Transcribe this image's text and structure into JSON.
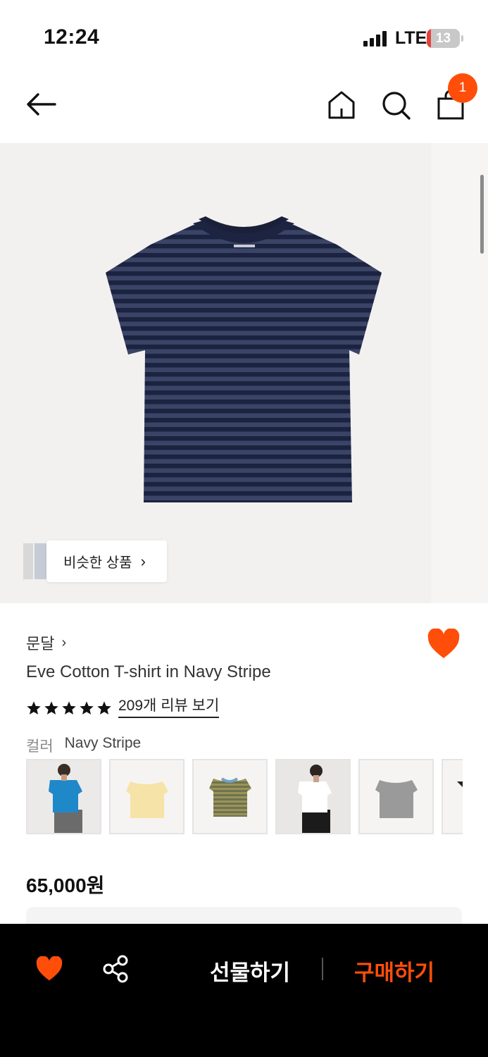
{
  "status_bar": {
    "time": "12:24",
    "network": "LTE",
    "battery": "13",
    "battery_level": 0.13
  },
  "top_nav": {
    "back_icon": "arrow-left-icon",
    "home_icon": "home-icon",
    "search_icon": "search-icon",
    "cart_icon": "shopping-bag-icon",
    "cart_count": "1",
    "badge_color": "#ff4e0a"
  },
  "hero": {
    "product_image": "navy-striped-tshirt",
    "similar_label": "비슷한 상품",
    "similar_chevron": "›"
  },
  "product": {
    "brand": "문달",
    "brand_chevron": "›",
    "title": "Eve Cotton T-shirt in Navy Stripe",
    "rating_stars": 5,
    "review_link": "209개 리뷰 보기",
    "color_label": "컬러",
    "color_value": "Navy Stripe",
    "swatches": [
      {
        "name": "blue-model"
      },
      {
        "name": "butter-yellow"
      },
      {
        "name": "olive-stripe"
      },
      {
        "name": "white-model"
      },
      {
        "name": "grey"
      },
      {
        "name": "partial"
      }
    ],
    "price": "65,000원",
    "liked": true
  },
  "bottom_bar": {
    "wish_icon": "heart-icon",
    "share_icon": "share-icon",
    "gift_label": "선물하기",
    "buy_label": "구매하기",
    "accent_color": "#ff4e0a"
  }
}
